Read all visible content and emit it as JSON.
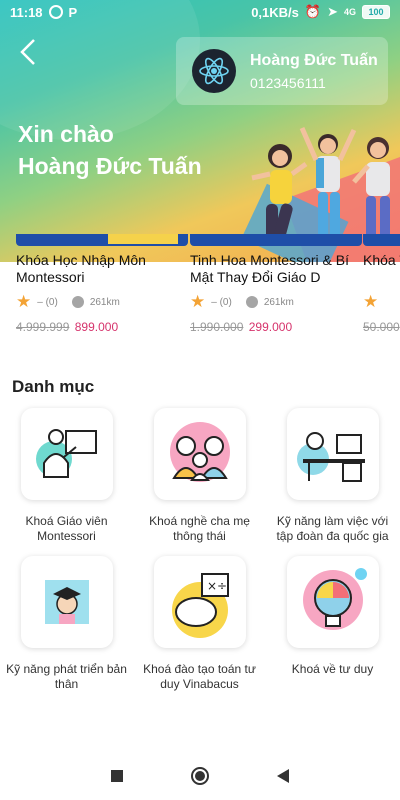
{
  "status_bar": {
    "time": "11:18",
    "app_badge": "P",
    "network_speed": "0,1KB/s",
    "signal_label": "4G",
    "battery": "100"
  },
  "header": {
    "user_name": "Hoàng Đức Tuấn",
    "user_phone": "0123456111",
    "greeting_line1": "Xin chào",
    "greeting_line2": "Hoàng Đức Tuấn"
  },
  "courses": [
    {
      "title": "Khóa Học Nhập Môn Montessori",
      "rating": "– (0)",
      "distance": "261km",
      "old_price": "4.999.999",
      "new_price": "899.000"
    },
    {
      "title": "Tinh Hoa Montessori & Bí Mật Thay Đổi Giáo D",
      "rating": "– (0)",
      "distance": "261km",
      "old_price": "1.990.000",
      "new_price": "299.000"
    },
    {
      "title": "Khóa Thấu",
      "rating": "",
      "distance": "",
      "old_price": "50.000",
      "new_price": ""
    }
  ],
  "categories_title": "Danh mục",
  "categories": [
    {
      "label": "Khoá Giáo viên Montessori",
      "icon": "teacher-board-icon"
    },
    {
      "label": "Khoá nghề cha mẹ thông thái",
      "icon": "family-icon"
    },
    {
      "label": "Kỹ năng làm việc với tập đoàn đa quốc gia",
      "icon": "office-desk-icon"
    },
    {
      "label": "Kỹ năng phát triển bản thân",
      "icon": "graduate-icon"
    },
    {
      "label": "Khoá đào tạo toán tư duy Vinabacus",
      "icon": "brain-math-icon"
    },
    {
      "label": "Khoá về tư duy",
      "icon": "lightbulb-icon"
    }
  ],
  "colors": {
    "accent_price": "#d6336c",
    "star": "#f3a335"
  }
}
